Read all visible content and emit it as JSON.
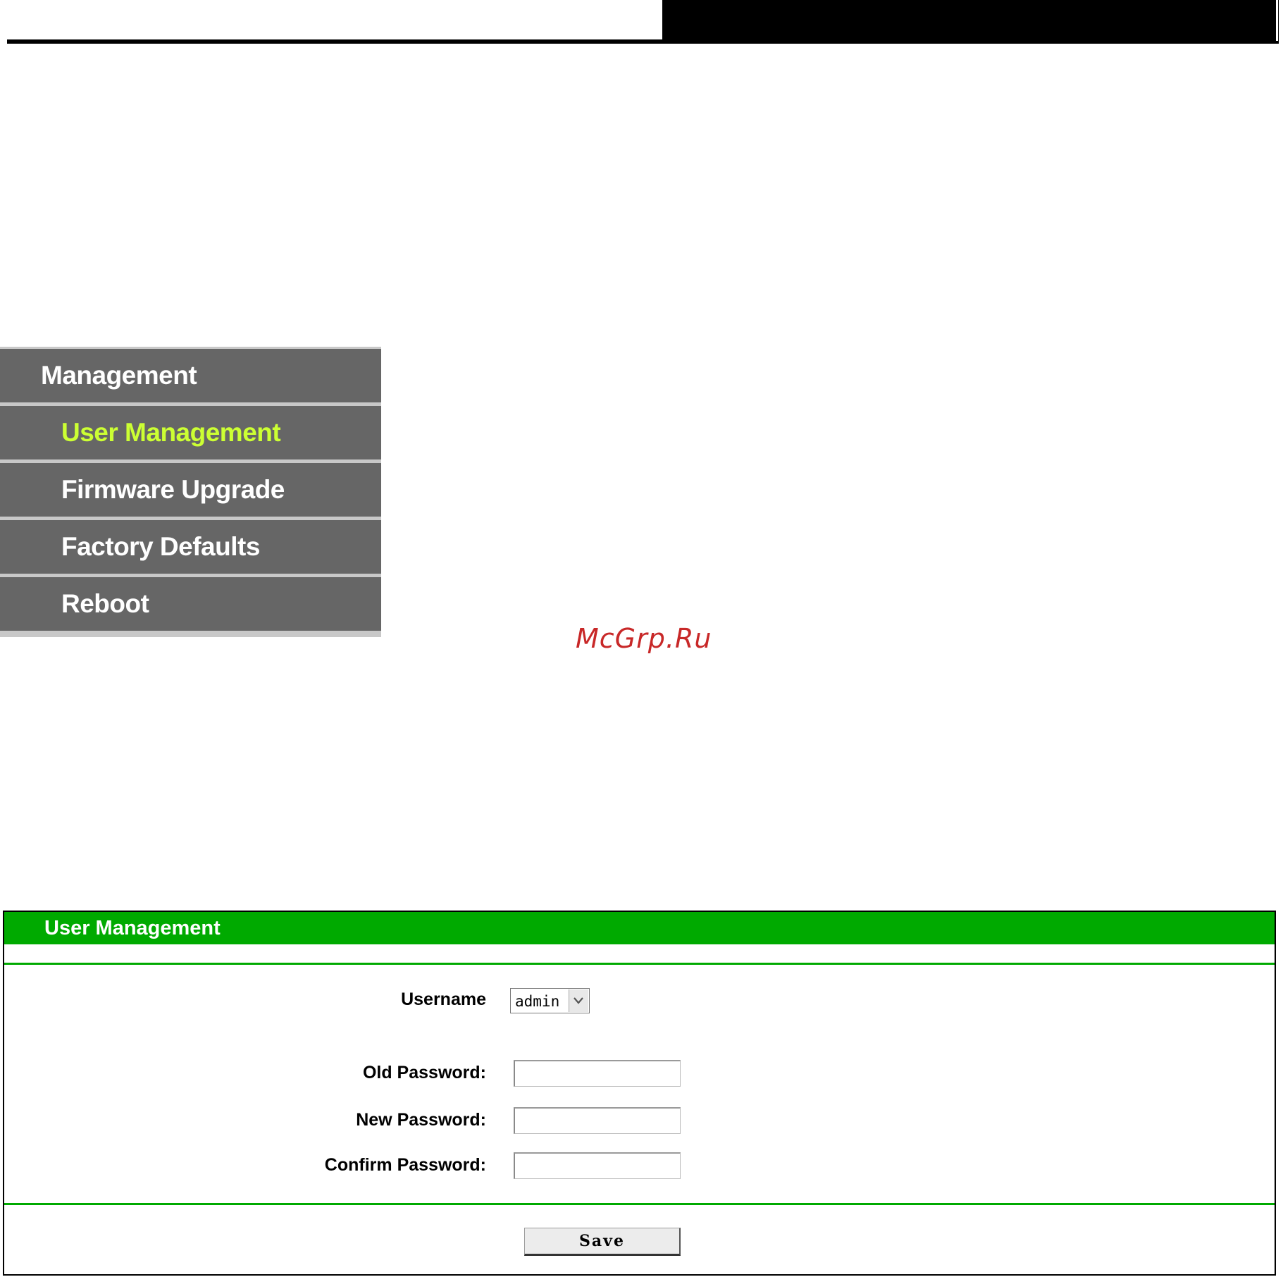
{
  "menu": {
    "header": "Management",
    "items": [
      {
        "label": "User Management",
        "active": true
      },
      {
        "label": "Firmware Upgrade",
        "active": false
      },
      {
        "label": "Factory Defaults",
        "active": false
      },
      {
        "label": "Reboot",
        "active": false
      }
    ],
    "active_color": "#ccff33",
    "bg_color": "#666666"
  },
  "watermark": "McGrp.Ru",
  "panel": {
    "title": "User Management",
    "accent_color": "#00aa00",
    "username_label": "Username",
    "username_value": "admin",
    "old_password_label": "Old Password:",
    "new_password_label": "New Password:",
    "confirm_password_label": "Confirm Password:",
    "old_password_value": "",
    "new_password_value": "",
    "confirm_password_value": "",
    "save_label": "Save"
  }
}
